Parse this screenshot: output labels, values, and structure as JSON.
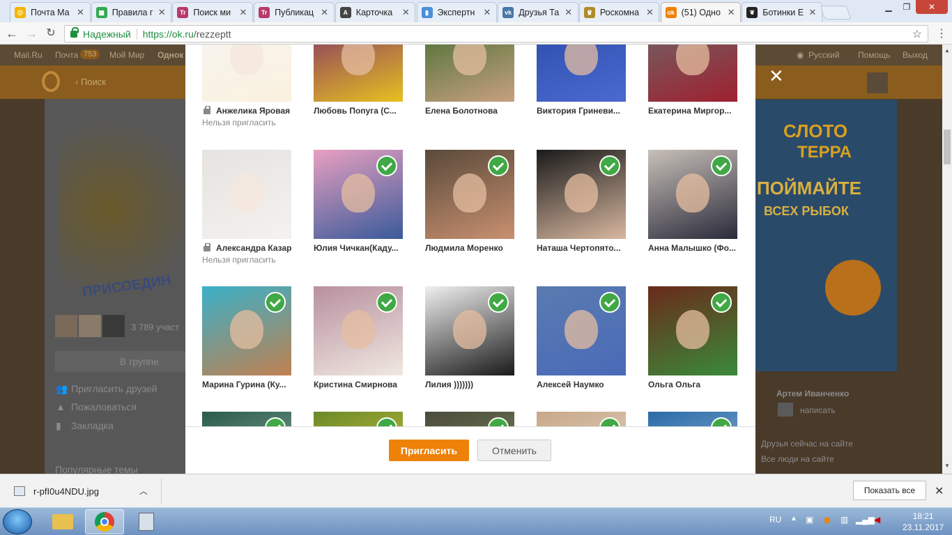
{
  "browser": {
    "tabs": [
      {
        "title": "Почта Ma",
        "color": "#f4b400",
        "glyph": "@"
      },
      {
        "title": "Правила г",
        "color": "#34a853",
        "glyph": "▦"
      },
      {
        "title": "Поиск ми",
        "color": "#b83a6a",
        "glyph": "Tr"
      },
      {
        "title": "Публикац",
        "color": "#b83a6a",
        "glyph": "Tr"
      },
      {
        "title": "Карточка",
        "color": "#444444",
        "glyph": "A"
      },
      {
        "title": "Экспертн",
        "color": "#4a90d9",
        "glyph": "▮"
      },
      {
        "title": "Друзья Та",
        "color": "#4a76a8",
        "glyph": "vk"
      },
      {
        "title": "Роскомна",
        "color": "#b08a2a",
        "glyph": "♛"
      },
      {
        "title": "(51) Одно",
        "color": "#ee8208",
        "glyph": "ok"
      },
      {
        "title": "Ботинки Е",
        "color": "#222222",
        "glyph": "❦"
      }
    ],
    "active_tab_index": 8,
    "secure_label": "Надежный",
    "url_host": "https://ok.ru",
    "url_path": "/rezzeptt"
  },
  "background_page": {
    "mailbar": [
      "Mail.Ru",
      "Почта",
      "Мой Мир",
      "Однок"
    ],
    "mail_count": "753",
    "lang": "Русский",
    "help": "Помощь",
    "logout": "Выход",
    "search_back": "Поиск",
    "members_count": "3 789 участ",
    "in_group": "В группе",
    "menu": [
      "Пригласить друзей",
      "Пожаловаться",
      "Закладка"
    ],
    "popular": "Популярные темы",
    "ad_title_1": "СЛОТО",
    "ad_title_2": "ТЕРРА",
    "ad_line_1": "ПОЙМАЙТЕ",
    "ad_line_2": "ВСЕХ РЫБОК",
    "group_banner": "ПРИСОЕДИН",
    "contact_name": "Артем Иванченко",
    "contact_action": "написать",
    "friends_online": "Друзья сейчас на сайте",
    "all_people": "Все люди на сайте"
  },
  "invite_dialog": {
    "friends": [
      {
        "name": "Анжелика Яровая",
        "locked": true,
        "note": "Нельзя пригласить",
        "c1": "#e8e4dc",
        "c2": "#f2d6a0"
      },
      {
        "name": "Любовь Попуга (С...",
        "locked": false,
        "checked": false,
        "c1": "#7a2a6a",
        "c2": "#e8c020"
      },
      {
        "name": "Елена Болотнова",
        "locked": false,
        "checked": false,
        "c1": "#3a6a2a",
        "c2": "#c8a080"
      },
      {
        "name": "Виктория Гриневи...",
        "locked": false,
        "checked": false,
        "c1": "#2a4aa8",
        "c2": "#4a6ad0"
      },
      {
        "name": "Екатерина Миргор...",
        "locked": false,
        "checked": false,
        "c1": "#6a6a6a",
        "c2": "#a02030"
      },
      {
        "name": "Александра Казар",
        "locked": true,
        "note": "Нельзя пригласить",
        "c1": "#b8b0a8",
        "c2": "#e0d8d0"
      },
      {
        "name": "Юлия Чичкан(Каду...",
        "locked": false,
        "checked": true,
        "c1": "#e8a0c0",
        "c2": "#3a5a9a"
      },
      {
        "name": "Людмила Моренко",
        "locked": false,
        "checked": true,
        "c1": "#5a4a3a",
        "c2": "#c89070"
      },
      {
        "name": "Наташа Чертопято...",
        "locked": false,
        "checked": true,
        "c1": "#1a1a1a",
        "c2": "#d8b8a0"
      },
      {
        "name": "Анна Малышко (Фо...",
        "locked": false,
        "checked": true,
        "c1": "#c8c0b8",
        "c2": "#2a2a3a"
      },
      {
        "name": "Марина Гурина (Ку...",
        "locked": false,
        "checked": true,
        "c1": "#3ab0c8",
        "c2": "#c08050"
      },
      {
        "name": "Кристина Смирнова",
        "locked": false,
        "checked": true,
        "c1": "#b890a0",
        "c2": "#f0e8e0"
      },
      {
        "name": "Лилия )))))))",
        "locked": false,
        "checked": true,
        "c1": "#f0f0f0",
        "c2": "#1a1a1a"
      },
      {
        "name": "Алексей Наумко",
        "locked": false,
        "checked": true,
        "c1": "#5a7ab0",
        "c2": "#4a6ab8"
      },
      {
        "name": "Ольга Ольга",
        "locked": false,
        "checked": true,
        "c1": "#6a2a1a",
        "c2": "#3a8a3a"
      },
      {
        "name": "",
        "locked": false,
        "checked": true,
        "c1": "#2a5a4a",
        "c2": "#a0c0b0"
      },
      {
        "name": "",
        "locked": false,
        "checked": true,
        "c1": "#6a8a2a",
        "c2": "#e8d040"
      },
      {
        "name": "",
        "locked": false,
        "checked": true,
        "c1": "#4a4a3a",
        "c2": "#8a9a6a"
      },
      {
        "name": "",
        "locked": false,
        "checked": true,
        "c1": "#c8a888",
        "c2": "#e8e0d8"
      },
      {
        "name": "",
        "locked": false,
        "checked": true,
        "c1": "#2a6aa8",
        "c2": "#a8c8e0"
      }
    ],
    "invite_label": "Пригласить",
    "cancel_label": "Отменить"
  },
  "download_bar": {
    "file_name": "r-pfI0u4NDU.jpg",
    "show_all": "Показать все"
  },
  "taskbar": {
    "lang": "RU",
    "time": "18:21",
    "date": "23.11.2017"
  },
  "colors": {
    "ok_orange": "#ee8208",
    "check_green": "#41a846"
  }
}
